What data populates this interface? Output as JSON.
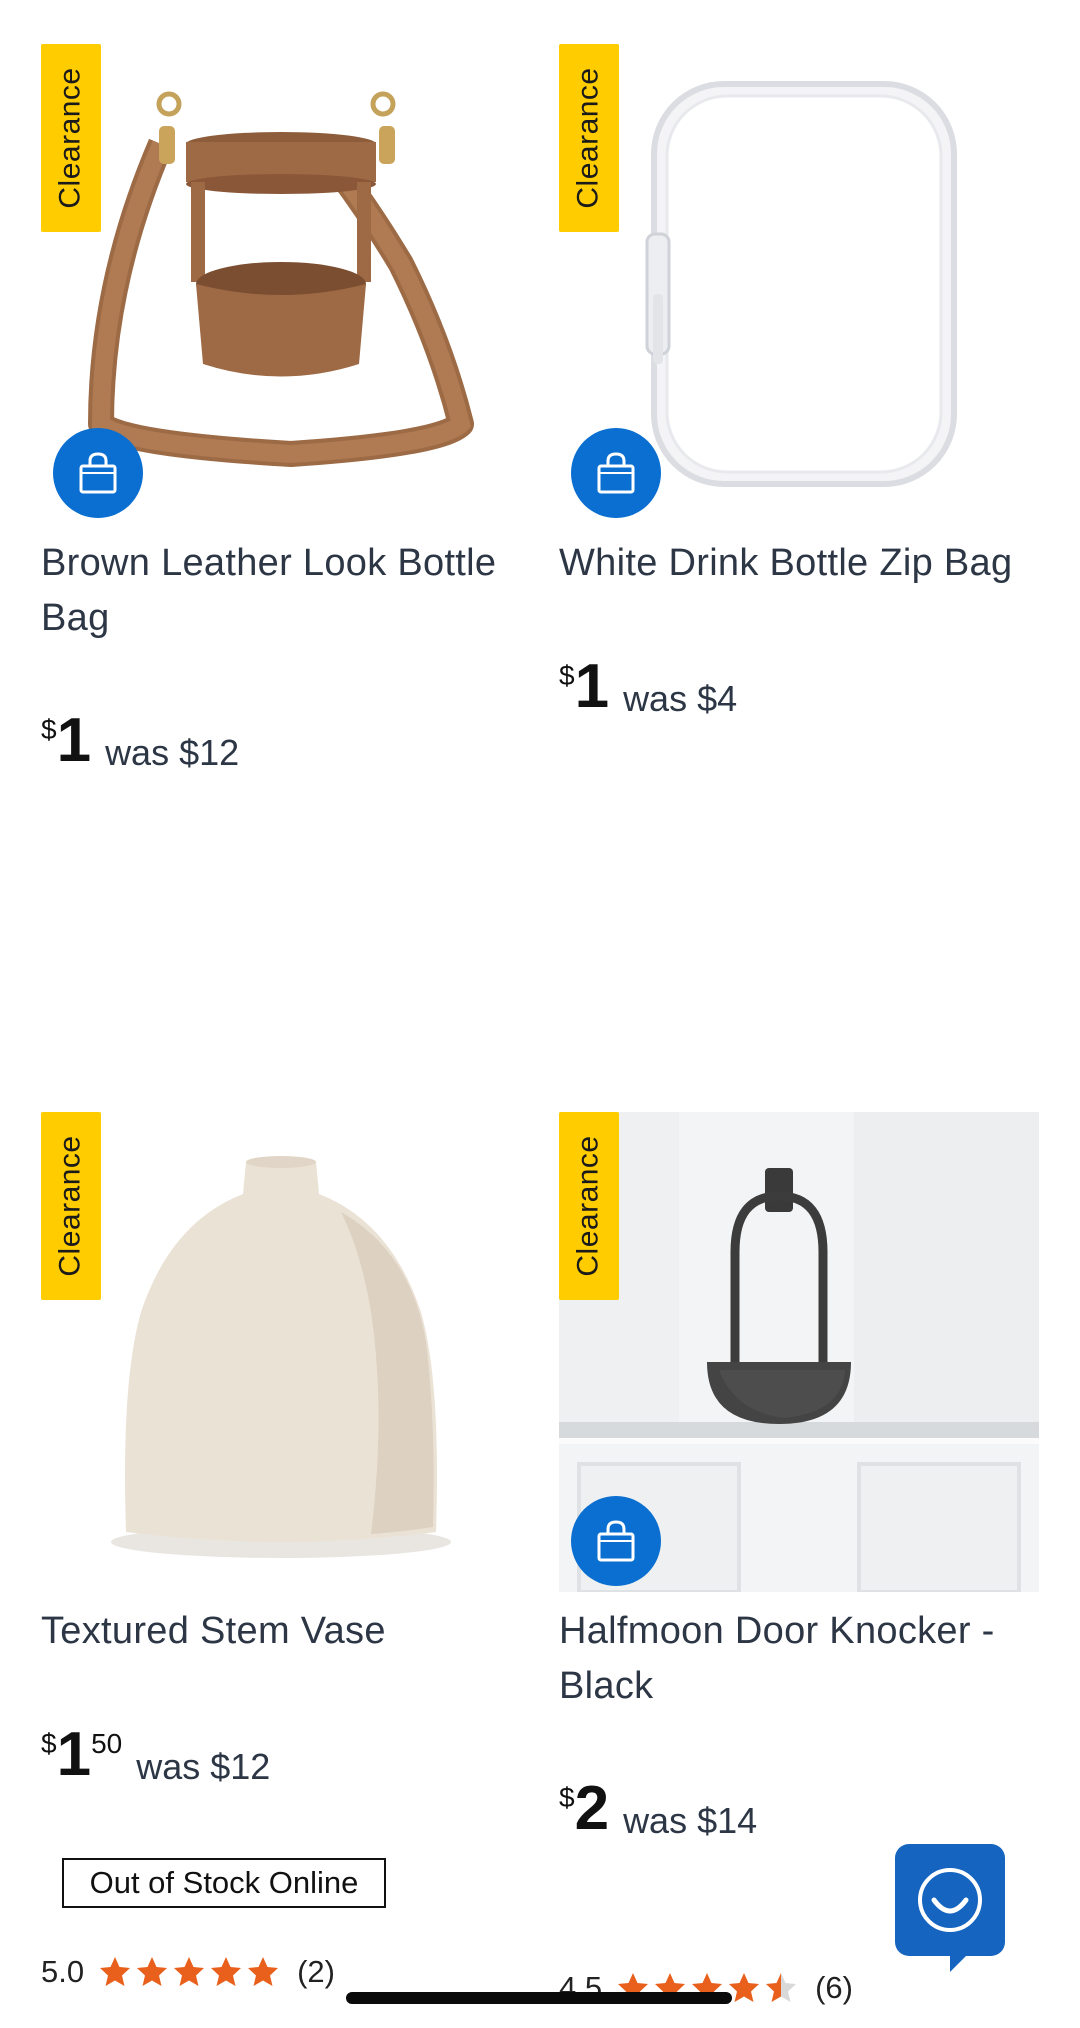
{
  "products": [
    {
      "badge": "Clearance",
      "title": "Brown Leather Look Bottle Bag",
      "price": {
        "currency": "$",
        "dollars": "1",
        "cents": "",
        "was": "was $12"
      },
      "image": "brown-bottle-bag",
      "has_cart_button": true
    },
    {
      "badge": "Clearance",
      "title": "White Drink Bottle Zip Bag",
      "price": {
        "currency": "$",
        "dollars": "1",
        "cents": "",
        "was": "was $4"
      },
      "image": "white-zip-bag",
      "has_cart_button": true
    },
    {
      "badge": "Clearance",
      "title": "Textured Stem Vase",
      "price": {
        "currency": "$",
        "dollars": "1",
        "cents": "50",
        "was": "was $12"
      },
      "image": "stem-vase",
      "has_cart_button": false,
      "stock_status": "Out of Stock Online",
      "rating": {
        "score": "5.0",
        "stars": 5,
        "count": "(2)"
      }
    },
    {
      "badge": "Clearance",
      "title": "Halfmoon Door Knocker - Black",
      "price": {
        "currency": "$",
        "dollars": "2",
        "cents": "",
        "was": "was $14"
      },
      "image": "door-knocker",
      "has_cart_button": true,
      "rating": {
        "score": "4.5",
        "stars": 4.5,
        "count": "(6)"
      }
    }
  ],
  "icons": {
    "cart": "shopping-bag-icon",
    "chat": "chat-smile-icon",
    "star": "star-icon"
  },
  "colors": {
    "badge": "#ffcc00",
    "cart_button": "#0a6fd1",
    "chat_button": "#1565c0",
    "star": "#e8601c",
    "star_empty": "#d9d9d9"
  }
}
